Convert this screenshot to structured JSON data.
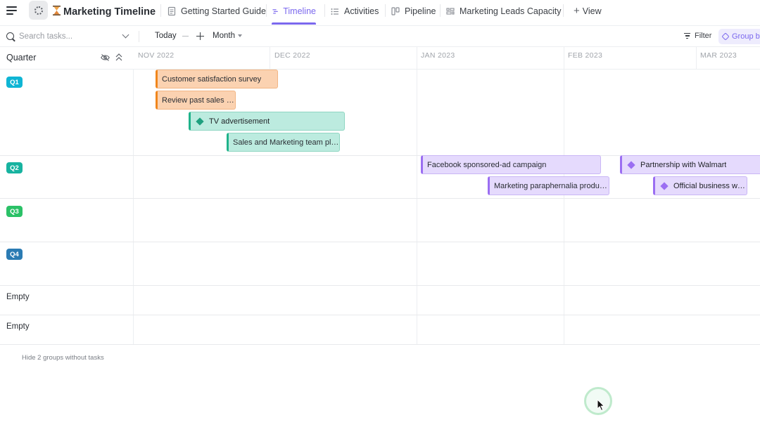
{
  "header": {
    "title": "Marketing Timeline",
    "tabs": [
      {
        "label": "Getting Started Guide",
        "icon": "doc-icon"
      },
      {
        "label": "Timeline",
        "icon": "timeline-icon",
        "active": true
      },
      {
        "label": "Activities",
        "icon": "list-icon"
      },
      {
        "label": "Pipeline",
        "icon": "board-icon"
      },
      {
        "label": "Marketing Leads Capacity",
        "icon": "workload-icon"
      }
    ],
    "add_view_label": "View"
  },
  "toolbar": {
    "search_placeholder": "Search tasks...",
    "today_label": "Today",
    "scale_label": "Month",
    "filter_label": "Filter",
    "groupby_label": "Group by"
  },
  "grid": {
    "group_column_label": "Quarter",
    "months": [
      "NOV 2022",
      "DEC 2022",
      "JAN 2023",
      "FEB 2023",
      "MAR 2023"
    ],
    "groups": [
      {
        "label": "Q1",
        "color": "#0fb5d4"
      },
      {
        "label": "Q2",
        "color": "#17b3a0"
      },
      {
        "label": "Q3",
        "color": "#2bc167"
      },
      {
        "label": "Q4",
        "color": "#2b7bb3"
      }
    ],
    "empty_groups": [
      "Empty",
      "Empty"
    ],
    "hide_groups_label": "Hide 2 groups without tasks"
  },
  "tasks": [
    {
      "name": "Customer satisfaction survey",
      "group": "Q1",
      "color": "orange",
      "milestone": false
    },
    {
      "name": "Review past sales a...",
      "group": "Q1",
      "color": "orange",
      "milestone": false
    },
    {
      "name": "TV advertisement",
      "group": "Q1",
      "color": "teal",
      "milestone": true
    },
    {
      "name": "Sales and Marketing team pla...",
      "group": "Q1",
      "color": "teal",
      "milestone": false
    },
    {
      "name": "Facebook sponsored-ad campaign",
      "group": "Q2",
      "color": "purple",
      "milestone": false
    },
    {
      "name": "Partnership with Walmart",
      "group": "Q2",
      "color": "purple",
      "milestone": true
    },
    {
      "name": "Marketing paraphernalia product...",
      "group": "Q2",
      "color": "purple",
      "milestone": false
    },
    {
      "name": "Official business we...",
      "group": "Q2",
      "color": "purple",
      "milestone": true
    }
  ]
}
